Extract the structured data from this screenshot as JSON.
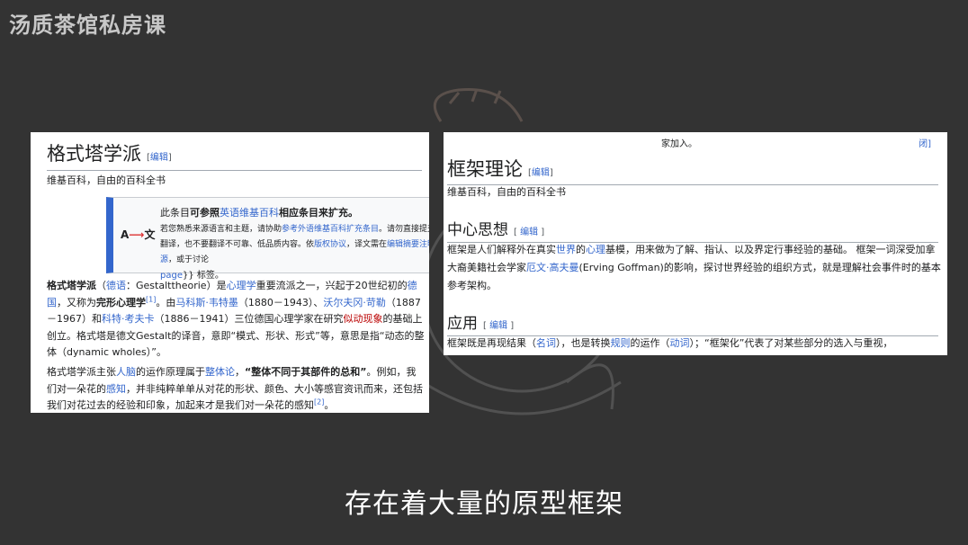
{
  "watermark": "汤质茶馆私房课",
  "subtitle": "存在着大量的原型框架",
  "left": {
    "title": "格式塔学派",
    "edit_label": "编辑",
    "tagline": "维基百科，自由的百科全书",
    "notice": {
      "logo_a": "A",
      "logo_arrow": "⟶",
      "logo_wen": "文",
      "line1_pre": "此条目",
      "line1_bold1": "可参照",
      "line1_link": "英语维基百科",
      "line1_bold2": "相应条目来扩充。",
      "line2_pre": "若您熟悉来源语言和主题，请协助",
      "line2_link": "参考外语维基百科扩充条目",
      "line2_post": "。请勿直接提交机械翻译，也不要翻译不可靠、低品质内容。依",
      "line2_link2": "版权协议",
      "line2_mid": "，译文需在",
      "line2_link3": "编辑摘要注明来源",
      "line2_tail": "，或于讨论",
      "line3_link": "page",
      "line3_post": "}} 标签。"
    },
    "p1": {
      "term": "格式塔学派",
      "s1": "（",
      "lang_link": "德语",
      "s2": "：",
      "german": "Gestalttheorie",
      "s3": "）是",
      "link_psych": "心理学",
      "s4": "重要流派之一，兴起于20世纪初的",
      "link_de": "德国",
      "s5": "，又称为",
      "bold_alt": "完形心理学",
      "ref1": "[1]",
      "s6": "。由",
      "link_w": "马科斯·韦特墨",
      "s7": "（1880－1943）、",
      "link_k": "沃尔夫冈·苛勒",
      "s8": "（1887－1967）和",
      "link_kf": "科特·考夫卡",
      "s9": "（1886－1941）三位德国心理学家在研究",
      "link_red": "似动现象",
      "s10": "的基础上创立。格式塔是德文Gestalt的译音，意即“模式、形状、形式”等，意思是指“动态的整体（dynamic wholes）”。"
    },
    "p2": {
      "s1": "格式塔学派主张",
      "link_brain": "人脑",
      "s2": "的运作原理属于",
      "link_holism": "整体论",
      "s3": "，",
      "bold_q": "“整体不同于其部件的总和”",
      "s4": "。例如，我们对一朵花的",
      "link_perc": "感知",
      "s5": "，并非纯粹单单从对花的形状、颜色、大小等感官资讯而来，还包括我们对花过去的经验和印象，加起来才是我们对一朵花的感知",
      "ref2": "[2]",
      "s6": "。"
    }
  },
  "right": {
    "top_fragment": "家加入。",
    "top_link_fragment": "闭]",
    "title": "框架理论",
    "edit_label": "编辑",
    "tagline": "维基百科，自由的百科全书",
    "sec1": "中心思想",
    "p1": {
      "s1": "框架是人们解释外在真实",
      "link_world": "世界",
      "s2": "的",
      "link_mind": "心理",
      "s3": "基模，用来做为了解、指认、以及界定行事经验的基础。 框架一词深受加拿大裔美籍社会学家",
      "link_goff": "厄文·高夫曼",
      "s4": "(Erving Goffman)的影响，探讨世界经验的组织方式，就是理解社会事件时的基本参考架构。"
    },
    "sec2": "应用",
    "p2": {
      "s1": "框架既是再现结果（",
      "link_noun": "名词",
      "s2": "），也是转换",
      "link_rule": "规则",
      "s3": "的运作（",
      "link_verb": "动词",
      "s4": "）；“框架化”代表了对某些部分的选入与重视，"
    }
  },
  "colors": {
    "background": "#333333",
    "link": "#3366cc",
    "redlink": "#ba0000",
    "notice_bar": "#3366cc"
  }
}
